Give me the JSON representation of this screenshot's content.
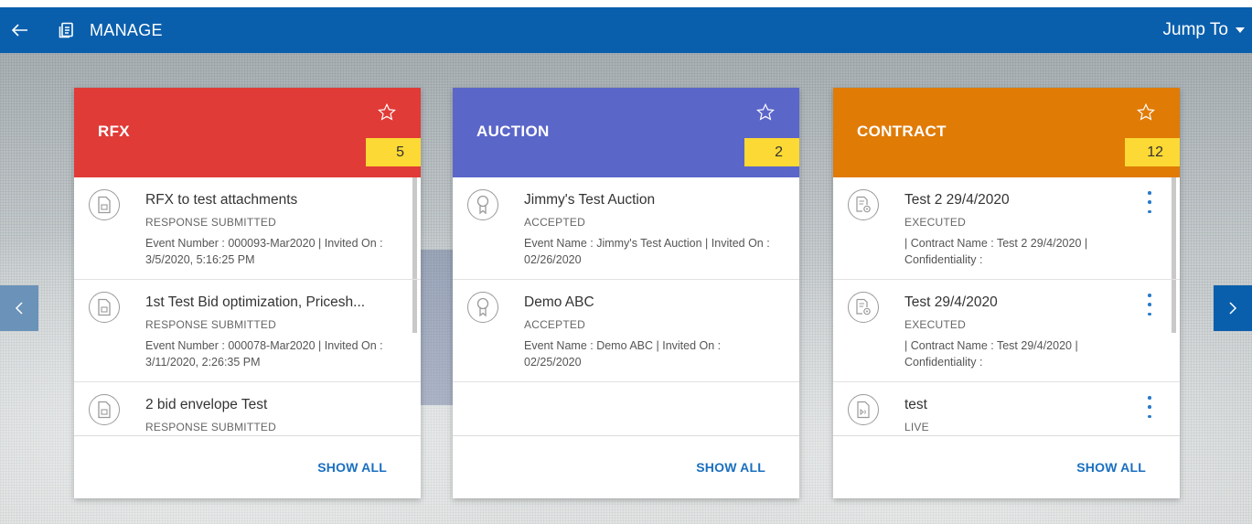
{
  "header": {
    "title": "MANAGE",
    "jump_to": "Jump To",
    "back_icon": "arrow-left-icon",
    "manage_icon": "manage-icon"
  },
  "colors": {
    "topbar": "#0a5fad",
    "rfx": "#e03b37",
    "auction": "#5b66c9",
    "contract": "#e07b06",
    "count_badge": "#fcd934",
    "link": "#1a6fc0"
  },
  "cards": [
    {
      "title": "RFX",
      "count": "5",
      "show_all": "SHOW ALL",
      "items": [
        {
          "title": "RFX to test attachments",
          "status": "RESPONSE SUBMITTED",
          "detail": "Event Number : 000093-Mar2020 | Invited On : 3/5/2020, 5:16:25 PM",
          "icon": "document-icon"
        },
        {
          "title": "1st Test Bid optimization, Pricesh...",
          "status": "RESPONSE SUBMITTED",
          "detail": "Event Number : 000078-Mar2020 | Invited On : 3/11/2020, 2:26:35 PM",
          "icon": "document-icon"
        },
        {
          "title": "2 bid envelope Test",
          "status": "RESPONSE SUBMITTED",
          "detail": "",
          "icon": "document-icon"
        }
      ]
    },
    {
      "title": "AUCTION",
      "count": "2",
      "show_all": "SHOW ALL",
      "items": [
        {
          "title": "Jimmy's Test Auction",
          "status": "ACCEPTED",
          "detail": "Event Name : Jimmy's Test Auction | Invited On : 02/26/2020",
          "icon": "award-ribbon-icon"
        },
        {
          "title": "Demo ABC",
          "status": "ACCEPTED",
          "detail": "Event Name : Demo ABC | Invited On : 02/25/2020",
          "icon": "award-ribbon-icon"
        }
      ]
    },
    {
      "title": "CONTRACT",
      "count": "12",
      "show_all": "SHOW ALL",
      "items": [
        {
          "title": "Test 2 29/4/2020",
          "status": "EXECUTED",
          "detail": "| Contract Name : Test 2 29/4/2020 | Confidentiality :",
          "icon": "contract-settings-icon"
        },
        {
          "title": "Test 29/4/2020",
          "status": "EXECUTED",
          "detail": "| Contract Name : Test 29/4/2020 | Confidentiality :",
          "icon": "contract-settings-icon"
        },
        {
          "title": "test",
          "status": "LIVE",
          "detail": "",
          "icon": "contract-live-icon"
        }
      ]
    }
  ]
}
